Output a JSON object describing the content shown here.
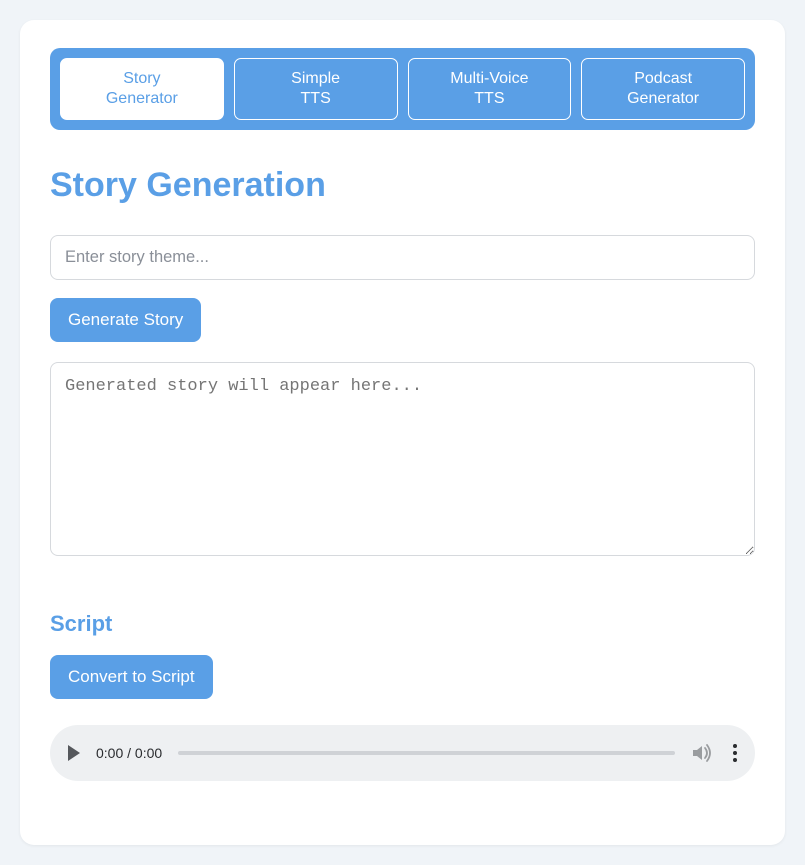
{
  "tabs": [
    {
      "label": "Story\nGenerator",
      "active": true
    },
    {
      "label": "Simple\nTTS",
      "active": false
    },
    {
      "label": "Multi-Voice\nTTS",
      "active": false
    },
    {
      "label": "Podcast\nGenerator",
      "active": false
    }
  ],
  "page_title": "Story Generation",
  "theme_input": {
    "placeholder": "Enter story theme...",
    "value": ""
  },
  "generate_button": "Generate Story",
  "output_placeholder": "Generated story will appear here...",
  "script_section_title": "Script",
  "convert_button": "Convert to Script",
  "audio": {
    "time": "0:00 / 0:00"
  },
  "colors": {
    "accent": "#5a9fe6"
  }
}
